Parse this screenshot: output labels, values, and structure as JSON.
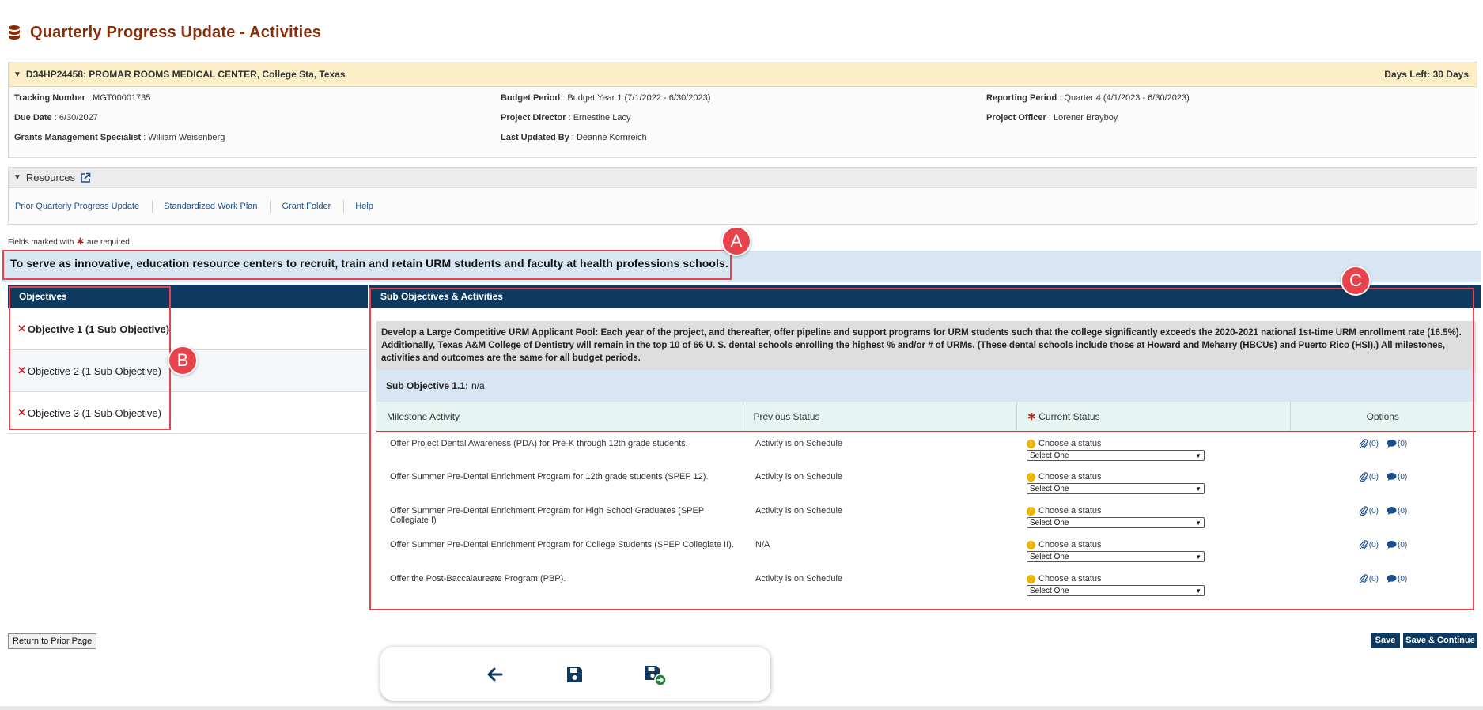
{
  "page": {
    "title": "Quarterly Progress Update - Activities"
  },
  "grant": {
    "header": "D34HP24458: PROMAR ROOMS MEDICAL CENTER, College Sta, Texas",
    "days_left": "Days Left: 30 Days",
    "fields": {
      "tracking_label": "Tracking Number",
      "tracking_value": "MGT00001735",
      "budget_label": "Budget Period",
      "budget_value": "Budget Year 1 (7/1/2022 - 6/30/2023)",
      "reporting_label": "Reporting Period",
      "reporting_value": "Quarter 4 (4/1/2023 - 6/30/2023)",
      "due_label": "Due Date",
      "due_value": "6/30/2027",
      "director_label": "Project Director",
      "director_value": "Ernestine Lacy",
      "officer_label": "Project Officer",
      "officer_value": "Lorener Brayboy",
      "gms_label": "Grants Management Specialist",
      "gms_value": "William Weisenberg",
      "updated_label": "Last Updated By",
      "updated_value": "Deanne Kornreich"
    }
  },
  "resources": {
    "title": "Resources",
    "links": [
      "Prior Quarterly Progress Update",
      "Standardized Work Plan",
      "Grant Folder",
      "Help"
    ]
  },
  "required_note": {
    "before": "Fields marked with",
    "after": "are required."
  },
  "goal": "To serve as innovative, education resource centers to recruit, train and retain URM students and faculty at health professions schools.",
  "objectives": {
    "header": "Objectives",
    "items": [
      "Objective 1 (1 Sub Objective)",
      "Objective 2 (1 Sub Objective)",
      "Objective 3 (1 Sub Objective)"
    ]
  },
  "sub_panel": {
    "header": "Sub Objectives & Activities",
    "description": "Develop a Large Competitive URM Applicant Pool: Each year of the project, and thereafter, offer pipeline and support programs for URM students such that the college significantly exceeds the 2020-2021 national 1st-time URM enrollment rate (16.5%). Additionally, Texas A&M College of Dentistry will remain in the top 10 of 66 U. S. dental schools enrolling the highest % and/or # of URMs. (These dental schools include those at Howard and Meharry (HBCUs) and Puerto Rico (HSI).) All milestones, activities and outcomes are the same for all budget periods.",
    "sub_objective_label": "Sub Objective 1.1:",
    "sub_objective_value": "n/a",
    "columns": {
      "milestone": "Milestone Activity",
      "previous": "Previous Status",
      "current": "Current Status",
      "options": "Options"
    },
    "choose_text": "Choose a status",
    "select_text": "Select One",
    "attach_count": "(0)",
    "comment_count": "(0)",
    "rows": [
      {
        "activity": "Offer Project Dental Awareness (PDA) for Pre-K through 12th grade students.",
        "previous": "Activity is on Schedule"
      },
      {
        "activity": "Offer Summer Pre-Dental Enrichment Program for 12th grade students (SPEP 12).",
        "previous": "Activity is on Schedule"
      },
      {
        "activity": "Offer Summer Pre-Dental Enrichment Program for High School Graduates (SPEP Collegiate I)",
        "previous": "Activity is on Schedule"
      },
      {
        "activity": "Offer Summer Pre-Dental Enrichment Program for College Students (SPEP Collegiate II).",
        "previous": "N/A"
      },
      {
        "activity": "Offer the Post-Baccalaureate Program (PBP).",
        "previous": "Activity is on Schedule"
      }
    ]
  },
  "annotations": {
    "a": "A",
    "b": "B",
    "c": "C"
  },
  "buttons": {
    "return": "Return to Prior Page",
    "save": "Save",
    "save_continue": "Save & Continue"
  },
  "toolbar": {
    "icons": [
      "back-arrow-icon",
      "save-icon",
      "save-and-continue-icon"
    ]
  },
  "colors": {
    "title": "#8a2c08",
    "navy": "#0f3a5f",
    "annotation": "#e8434c",
    "link": "#1a4f8b"
  }
}
